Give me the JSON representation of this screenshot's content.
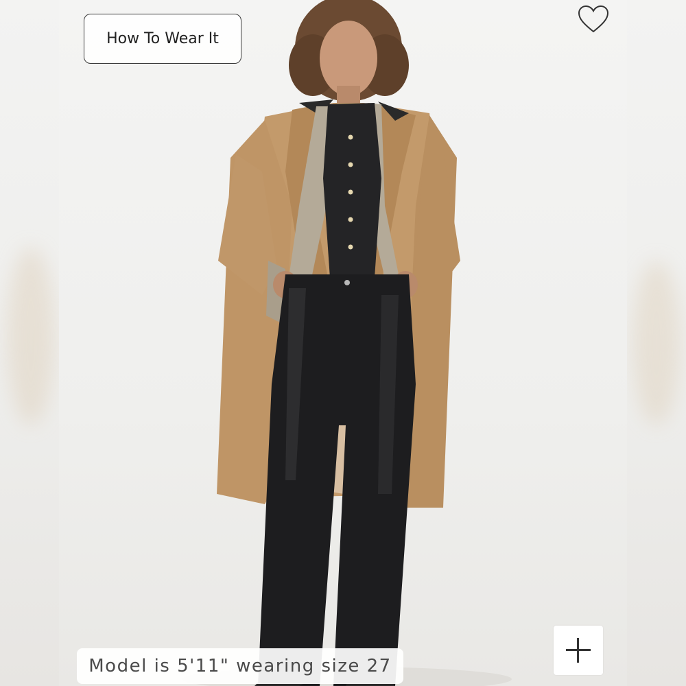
{
  "product": {
    "how_to_wear_label": "How To Wear It",
    "model_caption": "Model is 5'11\" wearing size 27"
  },
  "icons": {
    "favorite": "heart-icon",
    "expand": "plus-icon"
  },
  "colors": {
    "background": "#f6f6f6",
    "coat": "#c39a6b",
    "pants": "#1d1d1f",
    "shirt": "#242426",
    "text": "#222222"
  }
}
